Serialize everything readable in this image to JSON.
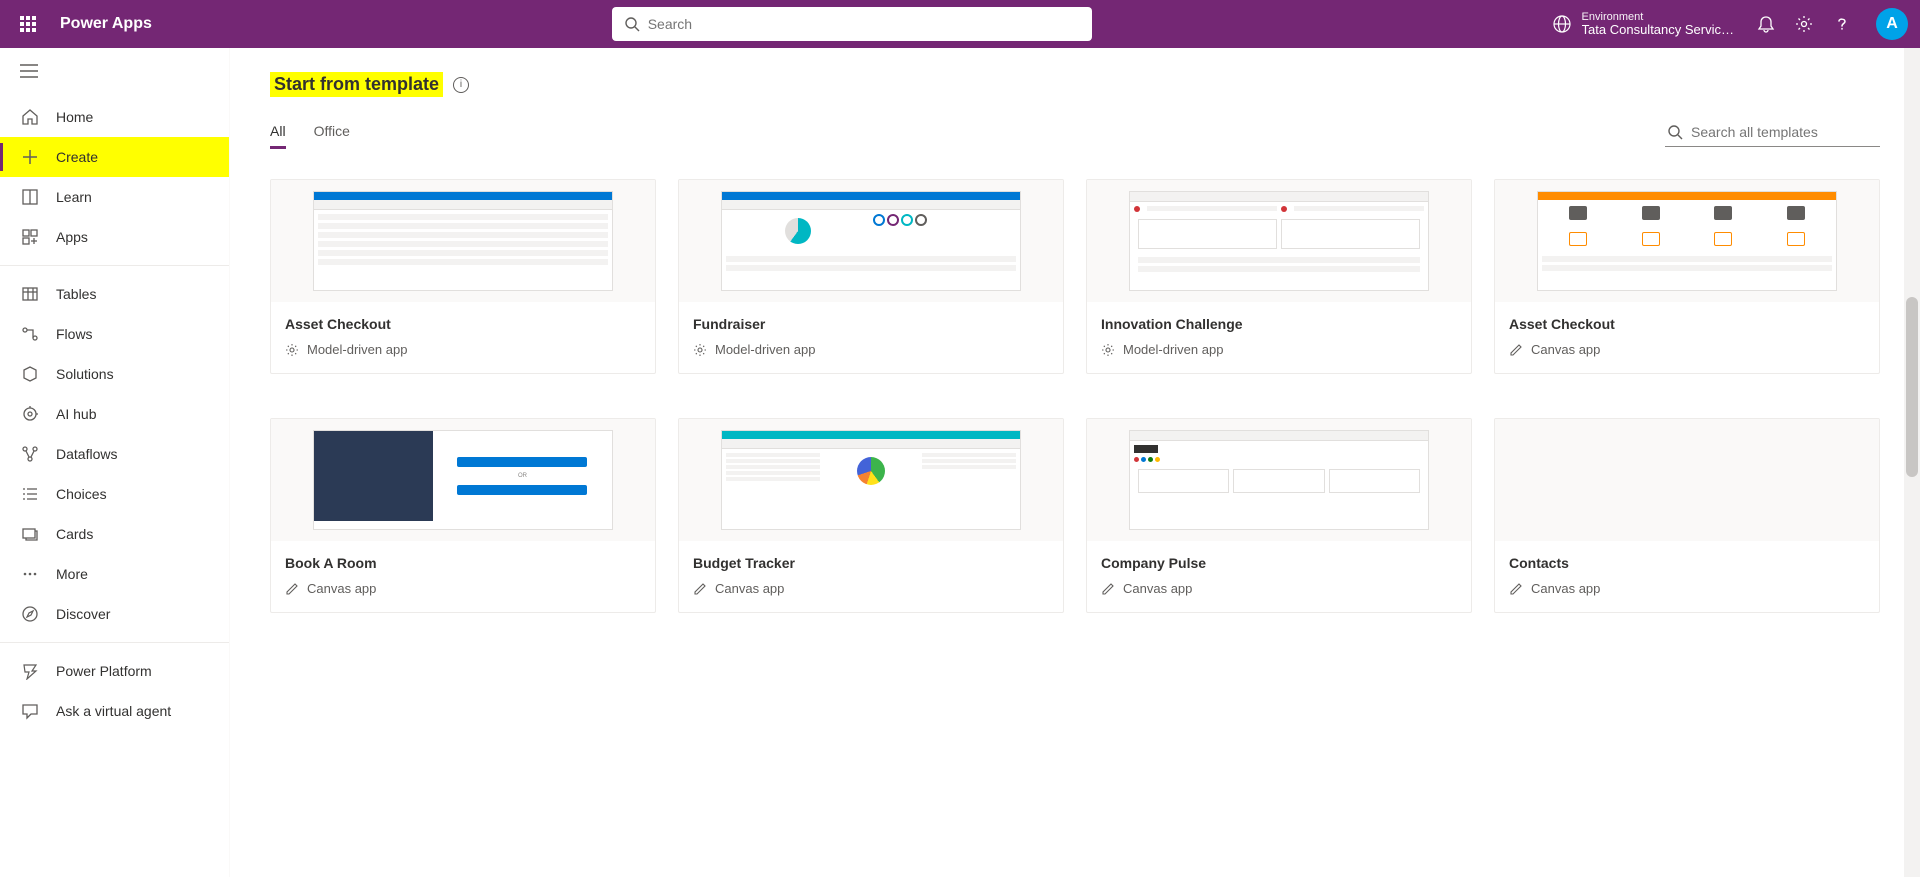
{
  "header": {
    "app_name": "Power Apps",
    "search_placeholder": "Search",
    "env_label": "Environment",
    "env_name": "Tata Consultancy Servic…",
    "avatar_initial": "A"
  },
  "sidebar": {
    "items": [
      {
        "label": "Home",
        "icon": "home"
      },
      {
        "label": "Create",
        "icon": "plus",
        "active": true,
        "highlight": true
      },
      {
        "label": "Learn",
        "icon": "book"
      },
      {
        "label": "Apps",
        "icon": "apps"
      }
    ],
    "items2": [
      {
        "label": "Tables",
        "icon": "table"
      },
      {
        "label": "Flows",
        "icon": "flow"
      },
      {
        "label": "Solutions",
        "icon": "solutions"
      },
      {
        "label": "AI hub",
        "icon": "ai"
      },
      {
        "label": "Dataflows",
        "icon": "dataflow"
      },
      {
        "label": "Choices",
        "icon": "choices"
      },
      {
        "label": "Cards",
        "icon": "cards"
      },
      {
        "label": "More",
        "icon": "more"
      },
      {
        "label": "Discover",
        "icon": "discover"
      }
    ],
    "items3": [
      {
        "label": "Power Platform",
        "icon": "pp"
      },
      {
        "label": "Ask a virtual agent",
        "icon": "chat"
      }
    ]
  },
  "main": {
    "section_title": "Start from template",
    "tabs": [
      "All",
      "Office"
    ],
    "active_tab": "All",
    "template_search_placeholder": "Search all templates",
    "templates_row1": [
      {
        "title": "Asset Checkout",
        "type": "Model-driven app",
        "type_icon": "gear",
        "preview": "table-blue"
      },
      {
        "title": "Fundraiser",
        "type": "Model-driven app",
        "type_icon": "gear",
        "preview": "pie-blue"
      },
      {
        "title": "Innovation Challenge",
        "type": "Model-driven app",
        "type_icon": "gear",
        "preview": "steps"
      },
      {
        "title": "Asset Checkout",
        "type": "Canvas app",
        "type_icon": "pencil",
        "preview": "products-orange"
      }
    ],
    "templates_row2": [
      {
        "title": "Book A Room",
        "type": "Canvas app",
        "type_icon": "pencil",
        "preview": "room"
      },
      {
        "title": "Budget Tracker",
        "type": "Canvas app",
        "type_icon": "pencil",
        "preview": "budget"
      },
      {
        "title": "Company Pulse",
        "type": "Canvas app",
        "type_icon": "pencil",
        "preview": "pulse"
      },
      {
        "title": "Contacts",
        "type": "Canvas app",
        "type_icon": "pencil",
        "preview": "blank"
      }
    ]
  }
}
